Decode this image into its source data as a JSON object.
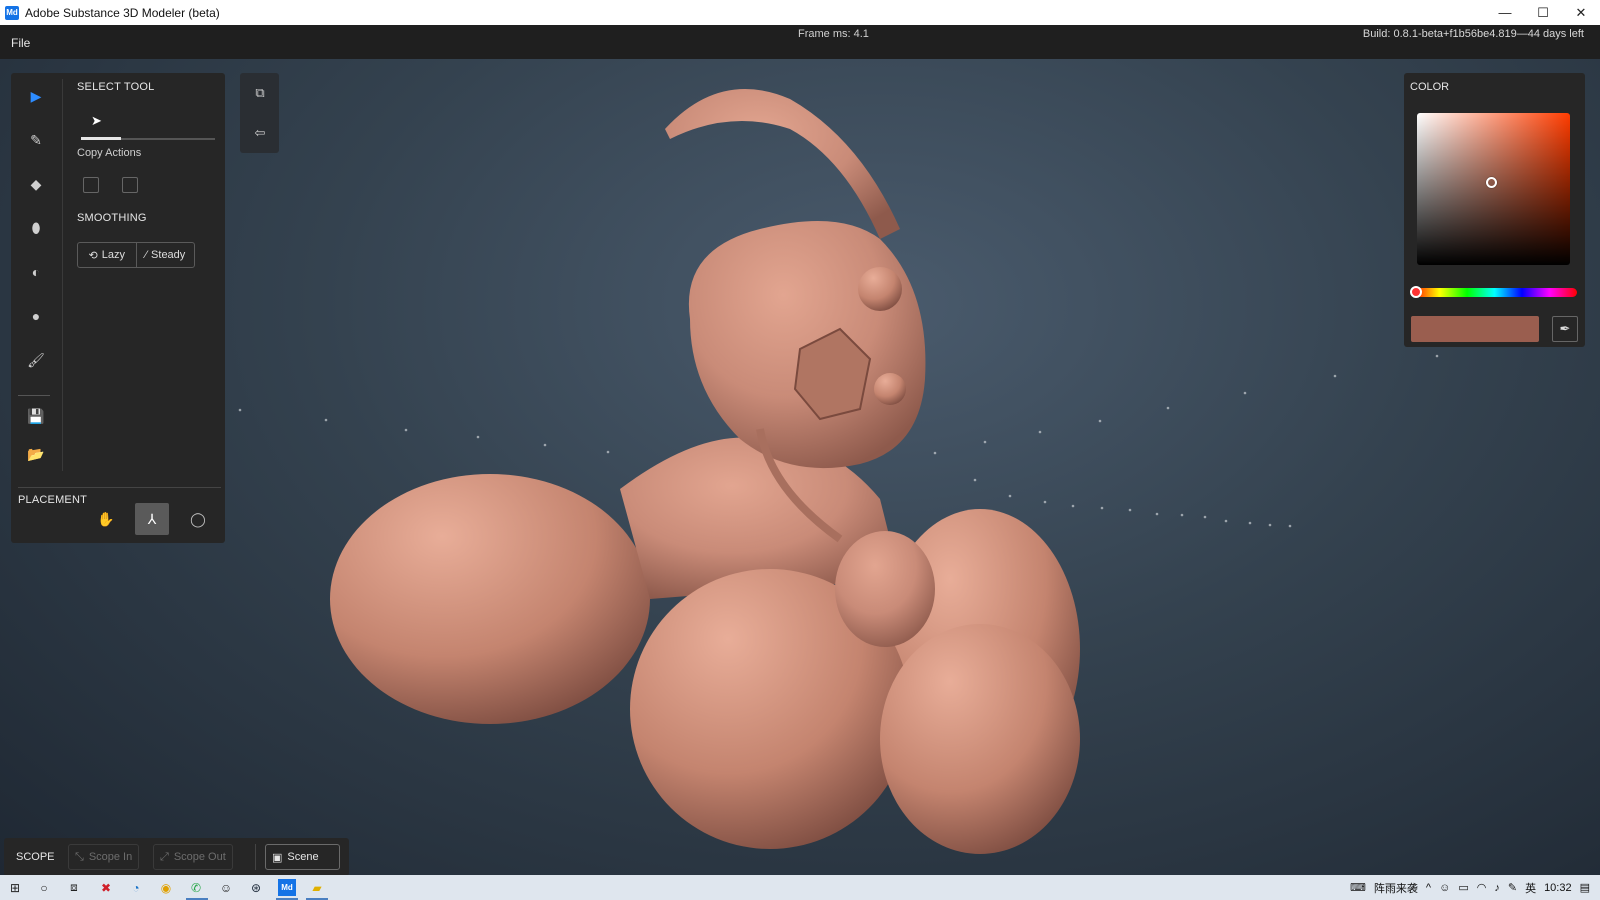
{
  "window": {
    "app_icon": "Md",
    "title": "Adobe Substance 3D Modeler (beta)",
    "controls": {
      "minimize": "—",
      "maximize": "☐",
      "close": "✕"
    }
  },
  "menubar": {
    "file_label": "File",
    "frame_ms": "Frame ms: 4.1",
    "build": "Build: 0.8.1-beta+f1b56be4.819—44 days left"
  },
  "tools": {
    "rail": [
      {
        "name": "select-tool",
        "icon": "arrow-icon",
        "active": true
      },
      {
        "name": "clay-tool",
        "icon": "clay-brush-icon",
        "active": false
      },
      {
        "name": "erase-tool",
        "icon": "eraser-icon",
        "active": false
      },
      {
        "name": "smooth-tool",
        "icon": "smooth-icon",
        "active": false
      },
      {
        "name": "move-tool",
        "icon": "move-icon",
        "active": false
      },
      {
        "name": "inflate-tool",
        "icon": "inflate-icon",
        "active": false
      },
      {
        "name": "paint-tool",
        "icon": "paint-brush-icon",
        "active": false
      },
      {
        "name": "save-tool",
        "icon": "save-icon",
        "active": false
      },
      {
        "name": "open-tool",
        "icon": "folder-icon",
        "active": false
      }
    ],
    "select_tool_title": "SELECT TOOL",
    "copy_actions_label": "Copy Actions",
    "smoothing_title": "SMOOTHING",
    "smoothing_lazy": "Lazy",
    "smoothing_steady": "Steady",
    "placement_title": "PLACEMENT"
  },
  "color": {
    "title": "COLOR",
    "base_hue_hex": "#ff3c00",
    "current_hex": "#9a5e4f"
  },
  "scope": {
    "title": "SCOPE",
    "scope_in": "Scope In",
    "scope_out": "Scope Out",
    "scene": "Scene"
  },
  "taskbar": {
    "ime_text": "阵雨来袭",
    "lang": "英",
    "time": "10:32"
  },
  "sculpt_color": "#c98b78"
}
